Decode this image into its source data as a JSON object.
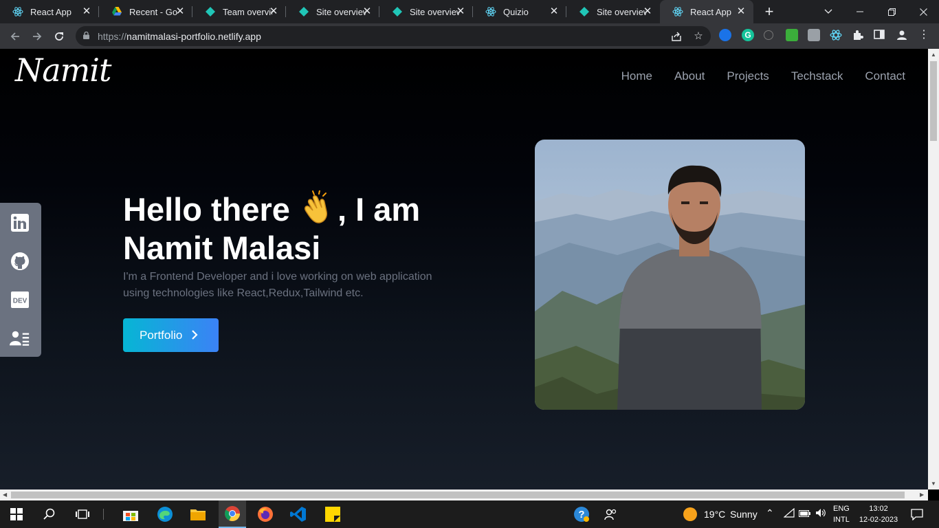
{
  "browser": {
    "tabs": [
      {
        "title": "React App",
        "favicon": "react-icon"
      },
      {
        "title": "Recent - Google Drive",
        "favicon": "google-drive-icon"
      },
      {
        "title": "Team overview",
        "favicon": "netlify-icon"
      },
      {
        "title": "Site overview",
        "favicon": "netlify-icon"
      },
      {
        "title": "Site overview",
        "favicon": "netlify-icon"
      },
      {
        "title": "Quizio",
        "favicon": "react-icon"
      },
      {
        "title": "Site overview",
        "favicon": "netlify-icon"
      },
      {
        "title": "React App",
        "favicon": "react-icon",
        "active": true
      }
    ],
    "url_protocol": "https://",
    "url_host": "namitmalasi-portfolio.netlify.app"
  },
  "site": {
    "logo": "Namit",
    "nav": [
      "Home",
      "About",
      "Projects",
      "Techstack",
      "Contact"
    ],
    "social": [
      "linkedin-icon",
      "github-icon",
      "dev-icon",
      "contact-card-icon"
    ],
    "dev_label": "DEV",
    "hero": {
      "title_part1": "Hello there",
      "title_part2": ", I am",
      "title_line2": "Namit Malasi",
      "description": "I'm a Frontend Developer and i love working on web application using technologies like React,Redux,Tailwind etc.",
      "button": "Portfolio"
    },
    "colors": {
      "accent_start": "#06b6d4",
      "accent_end": "#3b82f6"
    }
  },
  "taskbar": {
    "weather_temp": "19°C",
    "weather_desc": "Sunny",
    "lang_1": "ENG",
    "lang_2": "INTL",
    "time": "13:02",
    "date": "12-02-2023"
  }
}
